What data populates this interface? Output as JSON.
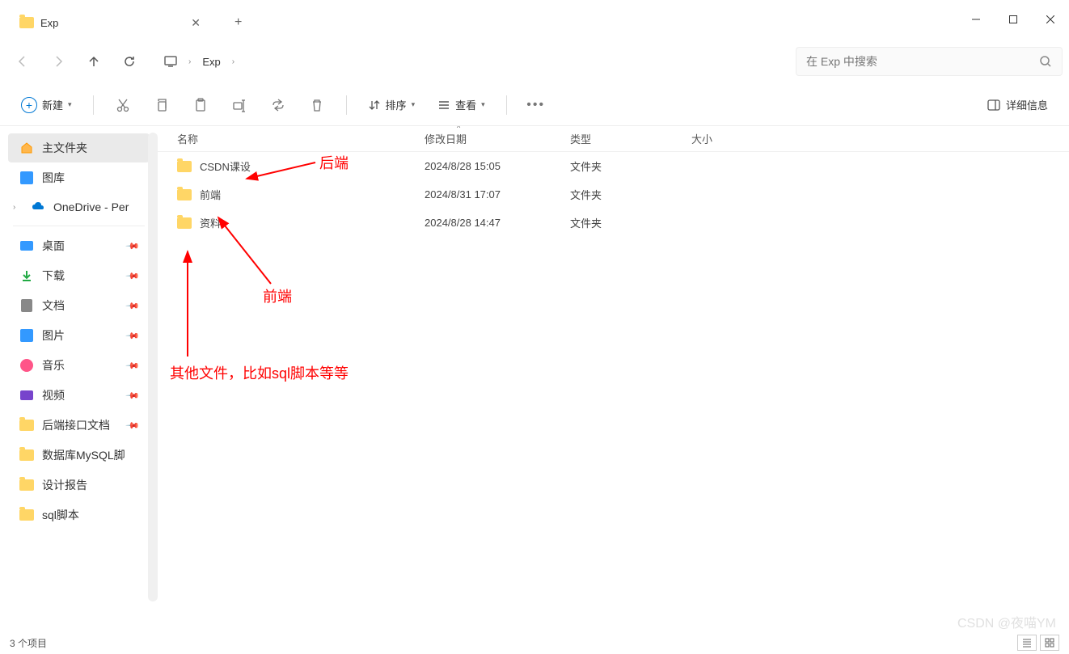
{
  "titlebar": {
    "tab_title": "Exp"
  },
  "navbar": {
    "breadcrumb_item": "Exp",
    "search_placeholder": "在 Exp 中搜索"
  },
  "toolbar": {
    "new_label": "新建",
    "sort_label": "排序",
    "view_label": "查看",
    "details_label": "详细信息"
  },
  "sidebar": {
    "home": "主文件夹",
    "gallery": "图库",
    "onedrive": "OneDrive - Per",
    "desktop": "桌面",
    "downloads": "下载",
    "documents": "文档",
    "pictures": "图片",
    "music": "音乐",
    "videos": "视频",
    "folder1": "后端接口文档",
    "folder2": "数据库MySQL脚",
    "folder3": "设计报告",
    "folder4": "sql脚本"
  },
  "columns": {
    "name": "名称",
    "date": "修改日期",
    "type": "类型",
    "size": "大小"
  },
  "files": [
    {
      "name": "CSDN课设",
      "date": "2024/8/28 15:05",
      "type": "文件夹"
    },
    {
      "name": "前端",
      "date": "2024/8/31 17:07",
      "type": "文件夹"
    },
    {
      "name": "资料",
      "date": "2024/8/28 14:47",
      "type": "文件夹"
    }
  ],
  "annotations": {
    "backend": "后端",
    "frontend": "前端",
    "other": "其他文件，比如sql脚本等等"
  },
  "statusbar": {
    "count": "3 个项目"
  },
  "watermark": "CSDN @夜喵YM"
}
